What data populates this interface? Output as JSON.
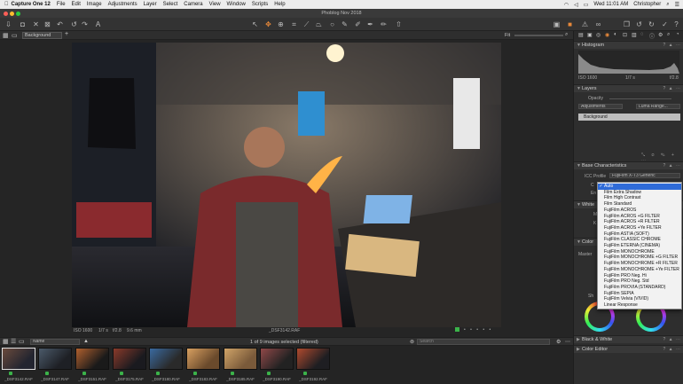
{
  "menubar": {
    "app_name": "Capture One 12",
    "items": [
      "File",
      "Edit",
      "Image",
      "Adjustments",
      "Layer",
      "Select",
      "Camera",
      "View",
      "Window",
      "Scripts",
      "Help"
    ],
    "clock": "Wed 11:01 AM",
    "user": "Christopher"
  },
  "window": {
    "title": "Phoblog Nov 2018"
  },
  "subbar": {
    "collection_select": "Background",
    "fit_label": "Fit"
  },
  "viewer": {
    "meta": {
      "iso": "ISO 1600",
      "shutter": "1/7 s",
      "aperture": "f/2.8",
      "focal": "9.6 mm",
      "filename": "_DSF3142.RAF"
    }
  },
  "filmstrip": {
    "sort_label": "Name",
    "status": "1 of 9 images selected (filtered)",
    "search_placeholder": "Search",
    "thumbs": [
      {
        "label": "_DSF3142.RAF"
      },
      {
        "label": "_DSF3147.RAF"
      },
      {
        "label": "_DSF3151.RAF"
      },
      {
        "label": "_DSF3175.RAF"
      },
      {
        "label": "_DSF3180.RAF"
      },
      {
        "label": "_DSF3183.RAF"
      },
      {
        "label": "_DSF3185.RAF"
      },
      {
        "label": "_DSF3190.RAF"
      },
      {
        "label": "_DSF3192.RAF"
      }
    ]
  },
  "panel": {
    "histogram": {
      "title": "Histogram",
      "iso": "ISO 1600",
      "shutter": "1/7 s",
      "aperture": "f/2.8"
    },
    "layers": {
      "title": "Layers",
      "opacity_label": "Opacity",
      "adjustments_btn": "Adjustments",
      "luma_btn": "Luma Range...",
      "background_layer": "Background"
    },
    "base": {
      "title": "Base Characteristics",
      "icc_label": "ICC Profile",
      "icc_value": "FujiFilm X-T3 Generic",
      "curve_label": "C",
      "engine_label": "En"
    },
    "white_balance_label": "White",
    "wb_m": "M",
    "wb_k": "K",
    "color_label": "Color",
    "master_label": "Master",
    "sh_label": "Sh",
    "bw_title": "Black & White",
    "color_editor_title": "Color Editor"
  },
  "dropdown": {
    "items": [
      {
        "label": "Auto",
        "active": true
      },
      {
        "label": "Film Extra Shadow"
      },
      {
        "label": "Film High Contrast"
      },
      {
        "label": "Film Standard"
      },
      {
        "label": "FujiFilm ACROS"
      },
      {
        "label": "FujiFilm ACROS +G FILTER"
      },
      {
        "label": "FujiFilm ACROS +R FILTER"
      },
      {
        "label": "FujiFilm ACROS +Ye FILTER"
      },
      {
        "label": "FujiFilm ASTIA (SOFT)"
      },
      {
        "label": "FujiFilm CLASSIC CHROME"
      },
      {
        "label": "FujiFilm ETERNA (CINEMA)"
      },
      {
        "label": "FujiFilm MONOCHROME"
      },
      {
        "label": "FujiFilm MONOCHROME +G FILTER"
      },
      {
        "label": "FujiFilm MONOCHROME +R FILTER"
      },
      {
        "label": "FujiFilm MONOCHROME +Ye FILTER"
      },
      {
        "label": "FujiFilm PRO Neg. Hi"
      },
      {
        "label": "FujiFilm PRO Neg. Std"
      },
      {
        "label": "FujiFilm PROVIA (STANDARD)"
      },
      {
        "label": "FujiFilm SEPIA"
      },
      {
        "label": "FujiFilm Velvia (VIVID)"
      },
      {
        "label": "Linear Response"
      }
    ],
    "check_glyph": "✓"
  },
  "colors": {
    "accent": "#2f6bd8",
    "badge": "#3bb34a",
    "toolbar_active": "#e8893a"
  }
}
